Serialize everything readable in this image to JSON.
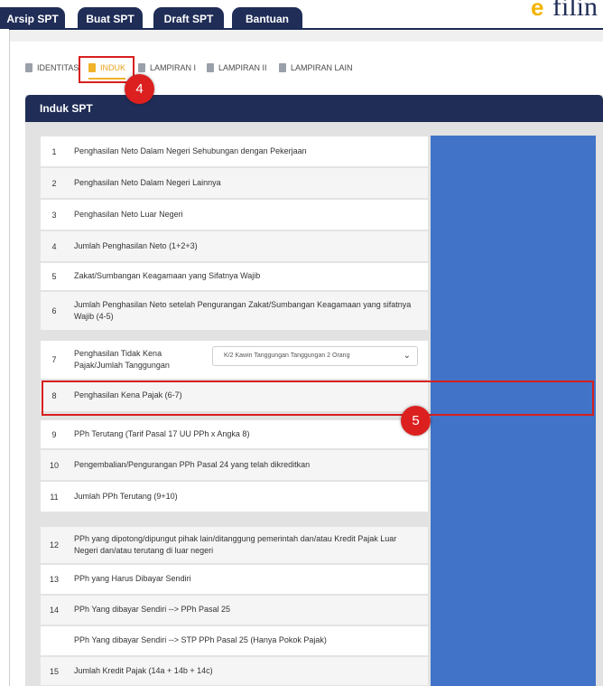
{
  "top_tabs": [
    "Arsip SPT",
    "Buat SPT",
    "Draft SPT",
    "Bantuan"
  ],
  "brand": {
    "text": "filin",
    "icon": "efiling-logo-icon"
  },
  "sub_tabs": [
    "IDENTITAS",
    "INDUK",
    "LAMPIRAN I",
    "LAMPIRAN II",
    "LAMPIRAN LAIN"
  ],
  "active_sub_tab": "INDUK",
  "panel_title": "Induk SPT",
  "rows": [
    {
      "num": "1",
      "label": "Penghasilan Neto Dalam Negeri Sehubungan dengan Pekerjaan"
    },
    {
      "num": "2",
      "label": "Penghasilan Neto Dalam Negeri Lainnya"
    },
    {
      "num": "3",
      "label": "Penghasilan Neto Luar Negeri"
    },
    {
      "num": "4",
      "label": "Jumlah Penghasilan Neto (1+2+3)"
    },
    {
      "num": "5",
      "label": "Zakat/Sumbangan Keagamaan yang Sifatnya Wajib"
    },
    {
      "num": "6",
      "label": "Jumlah Penghasilan Neto setelah Pengurangan Zakat/Sumbangan Keagamaan yang sifatnya Wajib (4-5)"
    },
    {
      "num": "7",
      "label": "Penghasilan Tidak Kena Pajak/Jumlah Tanggungan"
    },
    {
      "num": "8",
      "label": "Penghasilan Kena Pajak (6-7)"
    },
    {
      "num": "9",
      "label": "PPh Terutang (Tarif Pasal 17 UU PPh x Angka 8)"
    },
    {
      "num": "10",
      "label": "Pengembalian/Pengurangan PPh Pasal 24 yang telah dikreditkan"
    },
    {
      "num": "11",
      "label": "Jumlah PPh Terutang (9+10)"
    },
    {
      "num": "12",
      "label": "PPh yang dipotong/dipungut pihak lain/ditanggung pemerintah dan/atau Kredit Pajak Luar Negeri dan/atau terutang di luar negeri"
    },
    {
      "num": "13",
      "label": "PPh yang Harus Dibayar Sendiri"
    },
    {
      "num": "14",
      "label": "PPh Yang dibayar Sendiri --> PPh Pasal 25"
    },
    {
      "num": "",
      "label": "PPh Yang dibayar Sendiri --> STP PPh Pasal 25 (Hanya Pokok Pajak)"
    },
    {
      "num": "15",
      "label": "Jumlah Kredit Pajak (14a + 14b + 14c)"
    }
  ],
  "ptkp_select": {
    "value": "K/2 Kawin Tanggungan Tanggungan 2 Orang"
  },
  "annotations": {
    "step4": "4",
    "step5": "5"
  },
  "colors": {
    "navy": "#1f2d57",
    "accent": "#f0b42a",
    "highlight": "#d81f1f",
    "blue_panel": "#4174c8"
  }
}
